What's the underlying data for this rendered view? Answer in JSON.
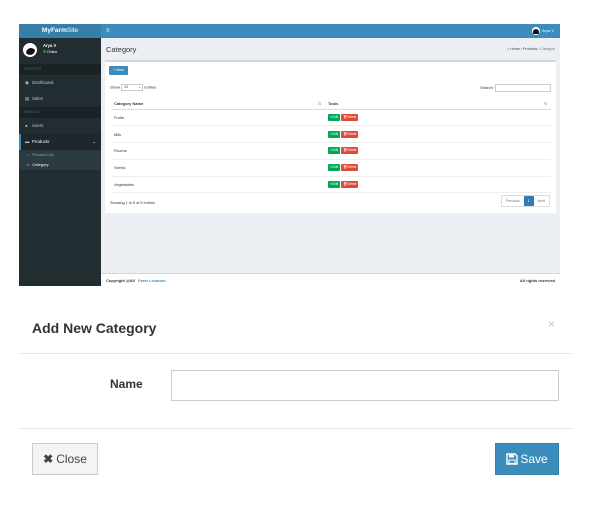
{
  "background": {
    "brand": {
      "bold": "MyFarm",
      "thin": "Site"
    },
    "user": {
      "name": "Arya V",
      "status": "Online"
    },
    "sidebar": {
      "header_reports": "REPORTS",
      "header_manage": "MANAGE",
      "items": [
        {
          "icon": "dashboard-icon",
          "label": "Dashboard"
        },
        {
          "icon": "sales-icon",
          "label": "Sales"
        },
        {
          "icon": "users-icon",
          "label": "Users"
        },
        {
          "icon": "products-icon",
          "label": "Products"
        }
      ],
      "subitems": [
        {
          "label": "Product List"
        },
        {
          "label": "Category"
        }
      ]
    },
    "topbar": {
      "user": "Arya V"
    },
    "page": {
      "title": "Category",
      "breadcrumb": [
        "Home",
        "Products",
        "Category"
      ],
      "new_button": "New",
      "show_label": "Show",
      "show_value": "10",
      "entries_label": "entries",
      "search_label": "Search:",
      "columns": [
        "Category Name",
        "Tools"
      ],
      "rows": [
        "Fruits",
        "Milk",
        "Rooms",
        "Seeds",
        "Vegetables"
      ],
      "edit_label": "Edit",
      "delete_label": "Delete",
      "showing": "Showing 1 to 5 of 5 entries",
      "pager": {
        "prev": "Previous",
        "current": "1",
        "next": "Next"
      }
    },
    "footer": {
      "copyright": "Copyright @AV",
      "link": "Farm Location",
      "rights": "All rights reserved"
    }
  },
  "modal": {
    "title": "Add New Category",
    "close_x": "×",
    "name_label": "Name",
    "name_value": "",
    "close_button": "Close",
    "save_button": "Save"
  }
}
